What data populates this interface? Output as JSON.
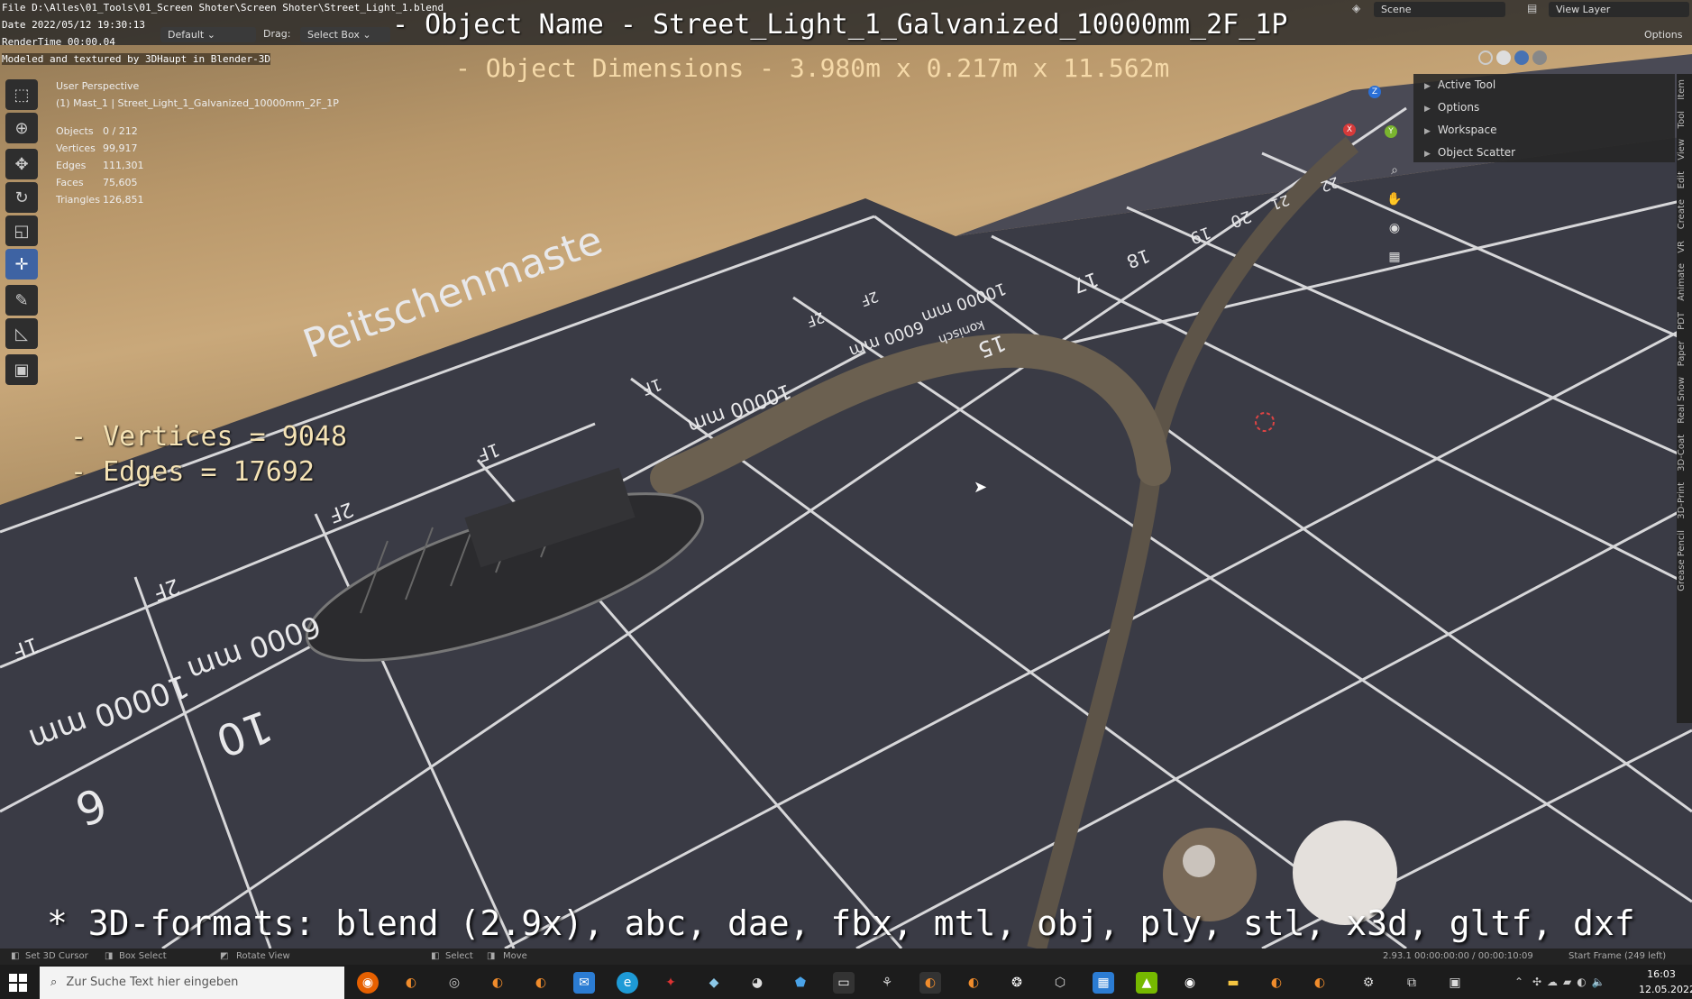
{
  "header": {
    "file_path": "File D:\\Alles\\01_Tools\\01_Screen Shoter\\Screen Shoter\\Street_Light_1.blend",
    "date": "Date 2022/05/12 19:30:13",
    "render_time": "RenderTime 00:00.04",
    "credit": "Modeled and textured by 3DHaupt in Blender-3D",
    "orientation_label": "Default",
    "drag_label": "Drag:",
    "drag_value": "Select Box",
    "scene_label": "Scene",
    "view_layer_label": "View Layer",
    "options_label": "Options"
  },
  "overlay": {
    "object_name": "- Object Name - Street_Light_1_Galvanized_10000mm_2F_1P",
    "object_dimensions": "- Object Dimensions -  3.980m x 0.217m x 11.562m",
    "vertices_line": "- Vertices = 9048",
    "edges_line": "- Edges = 17692",
    "formats_line": "* 3D-formats: blend (2.9x), abc, dae, fbx, mtl, obj, ply, stl, x3d, gltf, dxf"
  },
  "viewport_info": {
    "perspective": "User Perspective",
    "collection": "(1) Mast_1 | Street_Light_1_Galvanized_10000mm_2F_1P",
    "stats": [
      {
        "label": "Objects",
        "value": "0 / 212"
      },
      {
        "label": "Vertices",
        "value": "99,917"
      },
      {
        "label": "Edges",
        "value": "111,301"
      },
      {
        "label": "Faces",
        "value": "75,605"
      },
      {
        "label": "Triangles",
        "value": "126,851"
      }
    ]
  },
  "npanel": {
    "items": [
      "Active Tool",
      "Options",
      "Workspace",
      "Object Scatter"
    ],
    "tabs": [
      "Item",
      "Tool",
      "View",
      "Edit",
      "Create",
      "VR",
      "Animate",
      "PDT",
      "Paper",
      "Real Snow",
      "3D-Coat",
      "3D-Print",
      "Grease Pencil"
    ]
  },
  "floor_labels": {
    "title": "Peitschenmaste",
    "sizes": [
      "10000 mm",
      "6000 mm",
      "10000 mm",
      "10000 mm",
      "6000 mm"
    ],
    "numbers": [
      "6",
      "10",
      "15",
      "17",
      "18",
      "19",
      "20",
      "21",
      "22"
    ],
    "tags": [
      "1F",
      "2F",
      "2F",
      "1F",
      "1F",
      "2F",
      "2F"
    ],
    "konisch": "konisch"
  },
  "statusbar": {
    "left_items": [
      "Set 3D Cursor",
      "Box Select",
      "Rotate View"
    ],
    "mid_items": [
      "Select",
      "Move"
    ],
    "version": "2.93.1  00:00:00:00 / 00:00:10:09",
    "frame": "Start Frame (249 left)"
  },
  "taskbar": {
    "search_placeholder": "Zur Suche Text hier eingeben",
    "time": "16:03",
    "date": "12.05.2022"
  },
  "colors": {
    "accent_blue": "#3e63a3",
    "floor_dark": "#3c3c46",
    "grid_line": "#e8e8ea"
  }
}
